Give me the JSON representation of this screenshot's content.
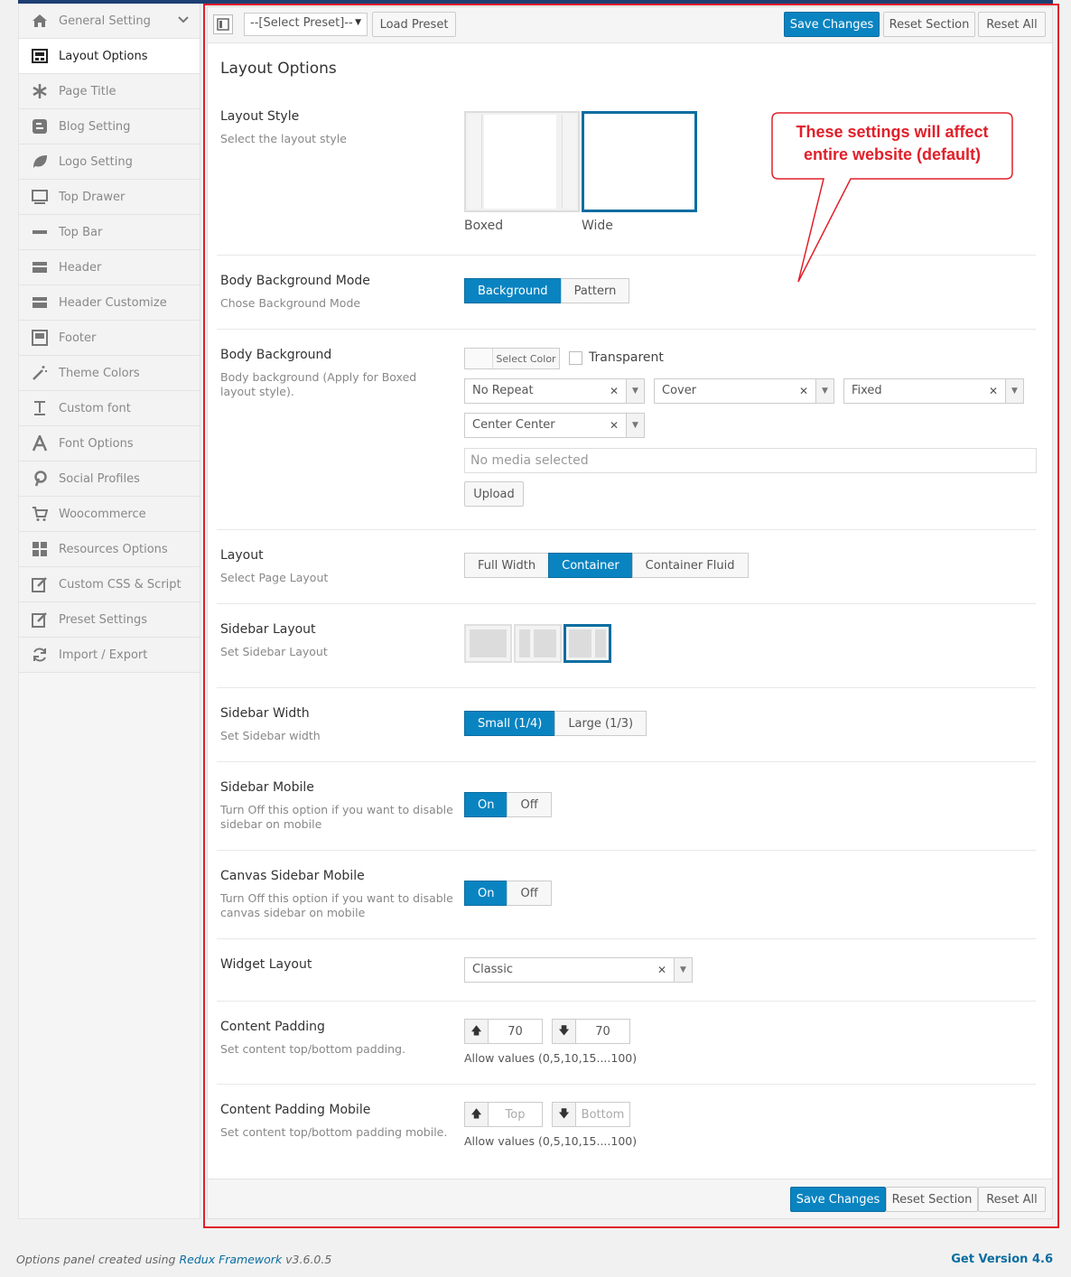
{
  "sidebar": {
    "items": [
      {
        "label": "General Setting",
        "icon": "home-icon"
      },
      {
        "label": "Layout Options",
        "icon": "layout-icon"
      },
      {
        "label": "Page Title",
        "icon": "asterisk-icon"
      },
      {
        "label": "Blog Setting",
        "icon": "blog-icon"
      },
      {
        "label": "Logo Setting",
        "icon": "leaf-icon"
      },
      {
        "label": "Top Drawer",
        "icon": "monitor-icon"
      },
      {
        "label": "Top Bar",
        "icon": "minus-icon"
      },
      {
        "label": "Header",
        "icon": "header-icon"
      },
      {
        "label": "Header Customize",
        "icon": "header-customize-icon"
      },
      {
        "label": "Footer",
        "icon": "footer-icon"
      },
      {
        "label": "Theme Colors",
        "icon": "magic-wand-icon"
      },
      {
        "label": "Custom font",
        "icon": "text-icon"
      },
      {
        "label": "Font Options",
        "icon": "font-icon"
      },
      {
        "label": "Social Profiles",
        "icon": "pinterest-icon"
      },
      {
        "label": "Woocommerce",
        "icon": "cart-icon"
      },
      {
        "label": "Resources Options",
        "icon": "grid-icon"
      },
      {
        "label": "Custom CSS & Script",
        "icon": "edit-icon"
      },
      {
        "label": "Preset Settings",
        "icon": "edit-icon"
      },
      {
        "label": "Import / Export",
        "icon": "refresh-icon"
      }
    ]
  },
  "toolbar": {
    "preset_select": "--[Select Preset]--",
    "load_preset": "Load Preset",
    "save": "Save Changes",
    "reset_section": "Reset Section",
    "reset_all": "Reset All"
  },
  "page": {
    "title": "Layout Options",
    "callout": "These settings will affect entire website (default)",
    "layout_style": {
      "label": "Layout Style",
      "desc": "Select the layout style",
      "options": [
        "Boxed",
        "Wide"
      ],
      "selected": "Wide"
    },
    "body_bg_mode": {
      "label": "Body Background Mode",
      "desc": "Chose Background Mode",
      "options": [
        "Background",
        "Pattern"
      ],
      "selected": "Background"
    },
    "body_bg": {
      "label": "Body Background",
      "desc": "Body background (Apply for Boxed layout style).",
      "select_color": "Select Color",
      "transparent": "Transparent",
      "repeat": "No Repeat",
      "size": "Cover",
      "attachment": "Fixed",
      "position": "Center Center",
      "media_placeholder": "No media selected",
      "upload": "Upload"
    },
    "layout": {
      "label": "Layout",
      "desc": "Select Page Layout",
      "options": [
        "Full Width",
        "Container",
        "Container Fluid"
      ],
      "selected": "Container"
    },
    "sidebar_layout": {
      "label": "Sidebar Layout",
      "desc": "Set Sidebar Layout"
    },
    "sidebar_width": {
      "label": "Sidebar Width",
      "desc": "Set Sidebar width",
      "options": [
        "Small (1/4)",
        "Large (1/3)"
      ],
      "selected": "Small (1/4)"
    },
    "sidebar_mobile": {
      "label": "Sidebar Mobile",
      "desc": "Turn Off this option if you want to disable sidebar on mobile",
      "on": "On",
      "off": "Off"
    },
    "canvas_sidebar_mobile": {
      "label": "Canvas Sidebar Mobile",
      "desc": "Turn Off this option if you want to disable canvas sidebar on mobile",
      "on": "On",
      "off": "Off"
    },
    "widget_layout": {
      "label": "Widget Layout",
      "value": "Classic"
    },
    "content_padding": {
      "label": "Content Padding",
      "desc": "Set content top/bottom padding.",
      "top": "70",
      "bottom": "70",
      "hint": "Allow values (0,5,10,15....100)"
    },
    "content_padding_mobile": {
      "label": "Content Padding Mobile",
      "desc": "Set content top/bottom padding mobile.",
      "top_ph": "Top",
      "bottom_ph": "Bottom",
      "hint": "Allow values (0,5,10,15....100)"
    }
  },
  "credit": {
    "prefix": "Options panel created using ",
    "link": "Redux Framework",
    "suffix": " v3.6.0.5"
  },
  "version": "Get Version 4.6",
  "colors": {
    "accent": "#0a84c1",
    "callout": "#e0202a"
  }
}
